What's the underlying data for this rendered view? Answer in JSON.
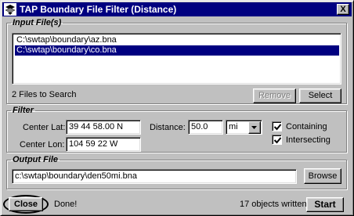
{
  "window": {
    "title": "TAP Boundary File Filter (Distance)",
    "close_glyph": "X",
    "titlebar_color": "#000080"
  },
  "input_files": {
    "legend": "Input File(s)",
    "items": [
      {
        "path": "C:\\swtap\\boundary\\az.bna",
        "selected": false
      },
      {
        "path": "C:\\swtap\\boundary\\co.bna",
        "selected": true
      }
    ],
    "count_text": "2 Files to Search",
    "remove_label": "Remove",
    "select_label": "Select"
  },
  "filter": {
    "legend": "Filter",
    "center_lat_label": "Center Lat:",
    "center_lat_value": "39 44 58.00 N",
    "center_lon_label": "Center Lon:",
    "center_lon_value": "104 59 22 W",
    "distance_label": "Distance:",
    "distance_value": "50.0",
    "unit_value": "mi",
    "containing_label": "Containing",
    "containing_checked": true,
    "intersecting_label": "Intersecting",
    "intersecting_checked": true
  },
  "output_file": {
    "legend": "Output File",
    "path": "c:\\swtap\\boundary\\den50mi.bna",
    "browse_label": "Browse"
  },
  "footer": {
    "close_label": "Close",
    "status_text": "Done!",
    "objects_text": "17 objects written",
    "start_label": "Start"
  }
}
